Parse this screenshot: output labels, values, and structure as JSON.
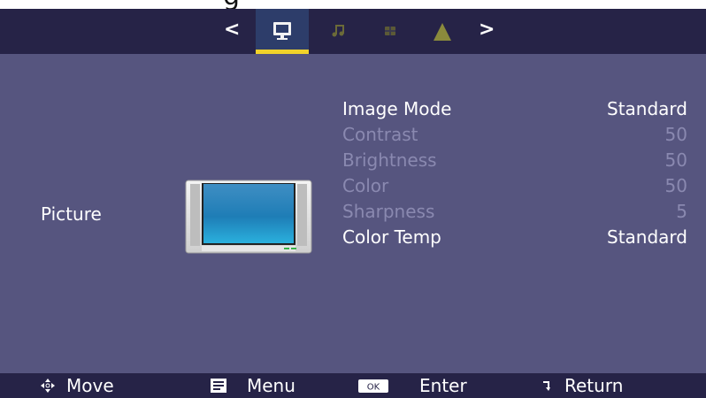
{
  "colors": {
    "nav_background": "#262347",
    "panel_background": "#56557f",
    "active_tab_background": "#2d3d6a",
    "active_tab_underline": "#f1d22a",
    "enabled_text": "#ffffff",
    "disabled_text": "#8a89b0"
  },
  "nav": {
    "prev_label": "<",
    "next_label": ">",
    "tabs": [
      {
        "icon": "monitor-icon",
        "active": true
      },
      {
        "icon": "music-note-icon",
        "active": false
      },
      {
        "icon": "channel-grid-icon",
        "active": false
      },
      {
        "icon": "lock-icon",
        "active": false
      }
    ]
  },
  "section": {
    "title": "Picture",
    "illustration": "tv-icon"
  },
  "settings": [
    {
      "label": "Image Mode",
      "value": "Standard",
      "enabled": true
    },
    {
      "label": "Contrast",
      "value": "50",
      "enabled": false
    },
    {
      "label": "Brightness",
      "value": "50",
      "enabled": false
    },
    {
      "label": "Color",
      "value": "50",
      "enabled": false
    },
    {
      "label": "Sharpness",
      "value": "5",
      "enabled": false
    },
    {
      "label": "Color Temp",
      "value": "Standard",
      "enabled": true
    }
  ],
  "hints": [
    {
      "icon": "dpad-icon",
      "label": "Move"
    },
    {
      "icon": "menu-icon",
      "label": "Menu"
    },
    {
      "icon": "ok-key-icon",
      "key": "OK",
      "label": "Enter"
    },
    {
      "icon": "return-arrow-icon",
      "label": "Return"
    }
  ]
}
